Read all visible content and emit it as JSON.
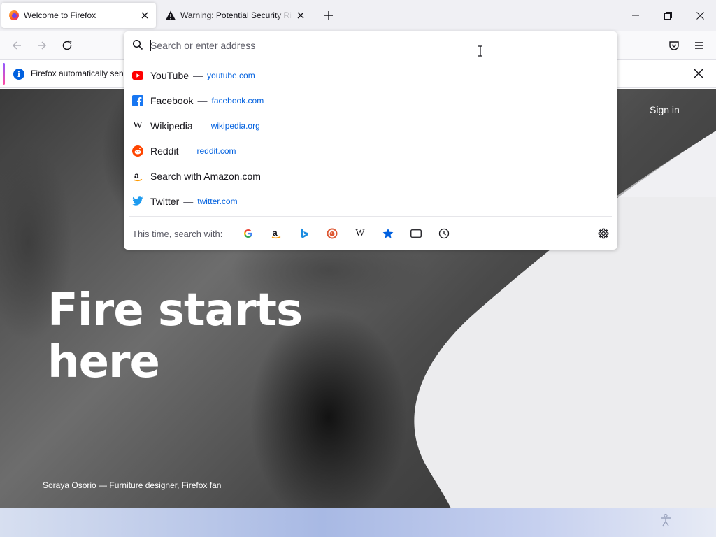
{
  "tabs": [
    {
      "label": "Welcome to Firefox",
      "icon": "firefox-icon",
      "active": true
    },
    {
      "label": "Warning: Potential Security Risk Ahead",
      "icon": "warning-icon",
      "active": false
    }
  ],
  "notification": {
    "text": "Firefox automatically sends some data to Mozilla so that we can improve your experience."
  },
  "urlbar": {
    "placeholder": "Search or enter address"
  },
  "suggestions": [
    {
      "title": "YouTube",
      "url": "youtube.com",
      "icon": "youtube-icon"
    },
    {
      "title": "Facebook",
      "url": "facebook.com",
      "icon": "facebook-icon"
    },
    {
      "title": "Wikipedia",
      "url": "wikipedia.org",
      "icon": "wikipedia-icon"
    },
    {
      "title": "Reddit",
      "url": "reddit.com",
      "icon": "reddit-icon"
    },
    {
      "title": "Search with Amazon.com",
      "url": "",
      "icon": "amazon-icon"
    },
    {
      "title": "Twitter",
      "url": "twitter.com",
      "icon": "twitter-icon"
    }
  ],
  "separator": "—",
  "oneoff": {
    "label": "This time, search with:",
    "engines": [
      "google-icon",
      "amazon-icon",
      "bing-icon",
      "duckduckgo-icon",
      "wikipedia-icon",
      "bookmarks-icon",
      "tabs-icon",
      "history-icon",
      "settings-icon"
    ]
  },
  "page": {
    "hero_title": "Fire starts here",
    "caption": "Soraya Osorio — Furniture designer, Firefox fan",
    "signin": "Sign in"
  },
  "colors": {
    "accent": "#0060df",
    "link": "#0060df",
    "tabstrip": "#f0f0f4"
  }
}
